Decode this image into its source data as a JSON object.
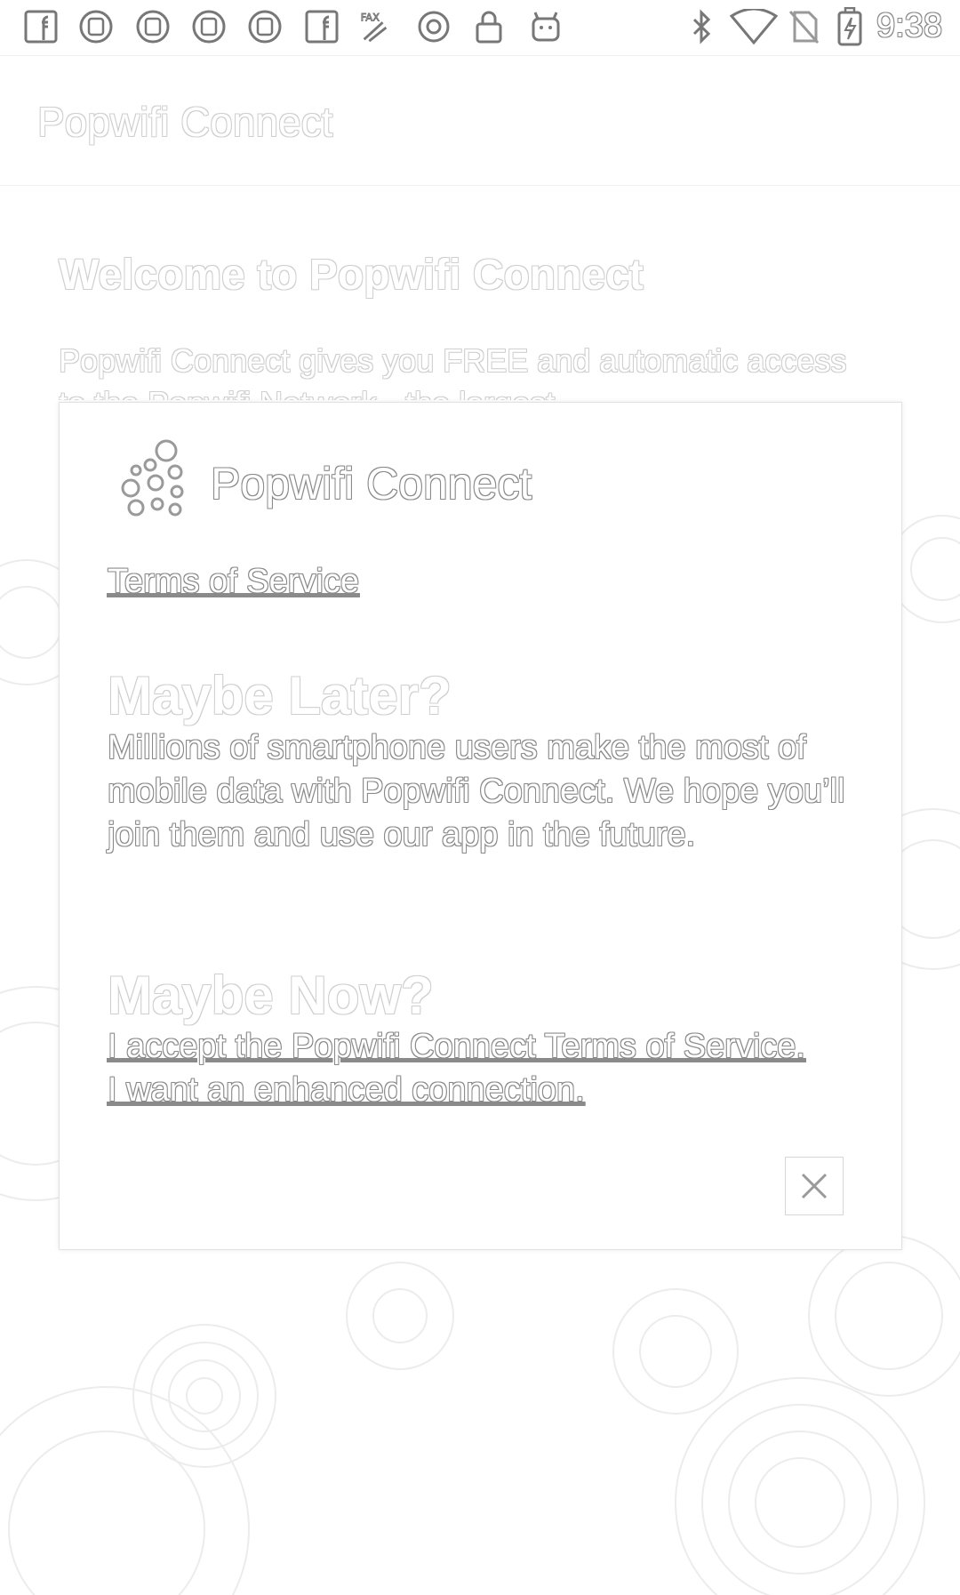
{
  "status_bar": {
    "time": "9:38",
    "left_icons": [
      "facebook-icon",
      "app-face-icon",
      "app-face-icon",
      "app-face-icon",
      "app-face-icon",
      "facebook-icon",
      "fax-icon",
      "circle-o-icon",
      "lock-icon",
      "android-icon"
    ],
    "right_icons": [
      "bluetooth-icon",
      "wifi-icon",
      "no-sim-icon",
      "battery-charging-icon"
    ]
  },
  "app_bar": {
    "title": "Popwifi Connect"
  },
  "welcome": {
    "title": "Welcome to Popwifi Connect",
    "body": "Popwifi Connect gives you FREE and automatic access to the Popwifi Network - the largest"
  },
  "dialog": {
    "title": "Popwifi Connect",
    "terms_link": "Terms of Service",
    "later_heading": "Maybe Later?",
    "later_body": "Millions of smartphone users make the most of mobile data with Popwifi Connect. We hope you’ll join them and use our app in the future.",
    "now_heading": "Maybe Now?",
    "accept_link": "I accept the Popwifi Connect Terms of Service. I want an enhanced connection.",
    "close_icon": "close-icon"
  }
}
